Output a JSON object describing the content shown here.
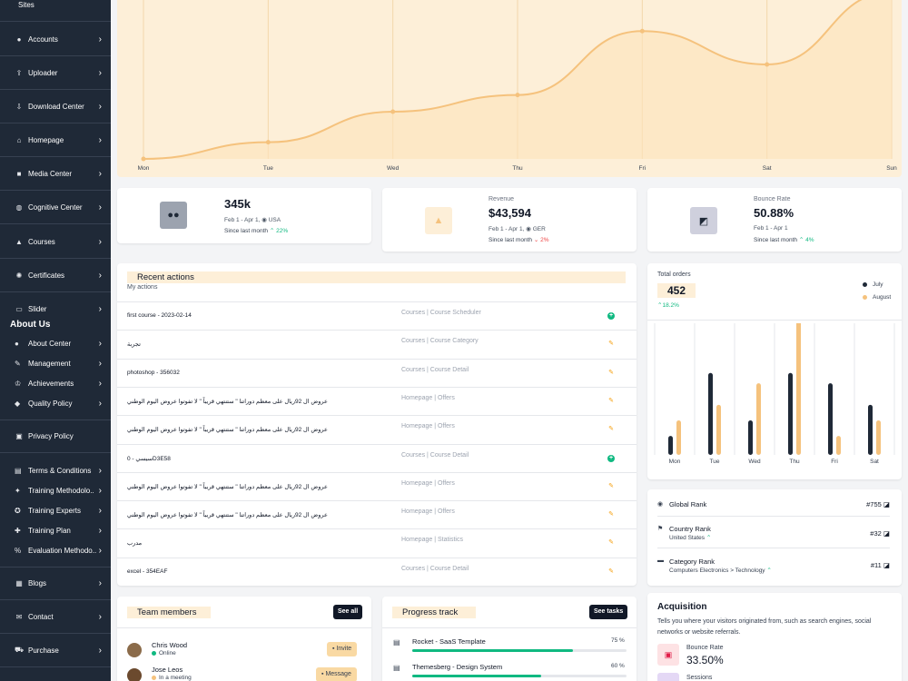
{
  "sidebar": {
    "items": [
      {
        "label": "Sites",
        "icon": "globe-icon"
      },
      {
        "label": "Accounts",
        "icon": "user-icon"
      },
      {
        "label": "Uploader",
        "icon": "upload-icon"
      },
      {
        "label": "Download Center",
        "icon": "download-icon"
      },
      {
        "label": "Homepage",
        "icon": "home-icon"
      },
      {
        "label": "Media Center",
        "icon": "video-icon"
      },
      {
        "label": "Cognitive Center",
        "icon": "brain-icon"
      },
      {
        "label": "Courses",
        "icon": "graduation-cap-icon"
      },
      {
        "label": "Certificates",
        "icon": "certificate-icon"
      },
      {
        "label": "Slider",
        "icon": "slider-icon"
      }
    ],
    "about_heading": "About Us",
    "about_items": [
      {
        "label": "About Center",
        "icon": "info-icon"
      },
      {
        "label": "Management",
        "icon": "gavel-icon"
      },
      {
        "label": "Achievements",
        "icon": "trophy-icon"
      },
      {
        "label": "Quality Policy",
        "icon": "shield-icon"
      }
    ],
    "privacy": {
      "label": "Privacy Policy",
      "icon": "lock-icon"
    },
    "group2": [
      {
        "label": "Terms & Conditions",
        "icon": "document-icon"
      },
      {
        "label": "Training Methodolo..",
        "icon": "method-icon"
      },
      {
        "label": "Training Experts",
        "icon": "expert-icon"
      },
      {
        "label": "Training Plan",
        "icon": "plan-icon"
      },
      {
        "label": "Evaluation Methodo..",
        "icon": "percent-icon"
      }
    ],
    "bottom": [
      {
        "label": "Blogs",
        "icon": "blog-icon"
      },
      {
        "label": "Contact",
        "icon": "mail-icon"
      },
      {
        "label": "Purchase",
        "icon": "cart-icon"
      }
    ]
  },
  "top_chart": {
    "days": [
      "Mon",
      "Tue",
      "Wed",
      "Thu",
      "Fri",
      "Sat",
      "Sun"
    ],
    "fill_color": "#fdefd8",
    "line_color": "#f5c27d"
  },
  "chart_data": [
    {
      "type": "area",
      "x": [
        "Mon",
        "Tue",
        "Wed",
        "Thu",
        "Fri",
        "Sat",
        "Sun"
      ],
      "values": [
        0.0,
        0.12,
        0.34,
        0.46,
        0.92,
        0.68,
        1.2
      ],
      "xlabel": "",
      "ylabel": "",
      "grid": true
    },
    {
      "type": "bar",
      "categories": [
        "Mon",
        "Tue",
        "Wed",
        "Thu",
        "Fri",
        "Sat"
      ],
      "series": [
        {
          "name": "July",
          "values": [
            22,
            95,
            40,
            95,
            83,
            58
          ],
          "color": "#1f2937"
        },
        {
          "name": "August",
          "values": [
            40,
            58,
            83,
            160,
            22,
            40
          ],
          "color": "#f5c27d"
        }
      ],
      "grid": true
    }
  ],
  "stats": [
    {
      "label": "",
      "value": "345k",
      "range": "Feb 1 - Apr 1,",
      "location": "USA",
      "since": "Since last month",
      "change": "22%",
      "direction": "up",
      "icon": "users-icon",
      "icon_bg": "#9ca3af"
    },
    {
      "label": "Revenue",
      "value": "$43,594",
      "range": "Feb 1 - Apr 1,",
      "location": "GER",
      "since": "Since last month",
      "change": "2%",
      "direction": "down",
      "icon": "shopping-bag-icon",
      "icon_bg": "#fdefd8"
    },
    {
      "label": "Bounce Rate",
      "value": "50.88%",
      "range": "Feb 1 - Apr 1",
      "location": "",
      "since": "Since last month",
      "change": "4%",
      "direction": "up",
      "icon": "presentation-icon",
      "icon_bg": "#cfd0dd"
    }
  ],
  "recent_actions": {
    "title": "Recent actions",
    "subtitle": "My actions",
    "rows": [
      {
        "name": "first course - 2023-02-14",
        "category": "Courses | Course Scheduler",
        "action": "add"
      },
      {
        "name": "تجربة",
        "category": "Courses | Course Category",
        "action": "edit"
      },
      {
        "name": "photoshop - 356032",
        "category": "Courses | Course Detail",
        "action": "edit"
      },
      {
        "name": "عروض ال 92ريال على معظم دوراتنا \" ستنتهي قريباً \" لا تفوتوا عروض اليوم الوطني",
        "category": "Homepage | Offers",
        "action": "edit"
      },
      {
        "name": "عروض ال 92ريال على معظم دوراتنا \" ستنتهي قريباً \" لا تفوتوا عروض اليوم الوطني",
        "category": "Homepage | Offers",
        "action": "edit"
      },
      {
        "name": "0 - سيسيD3E58",
        "category": "Courses | Course Detail",
        "action": "add"
      },
      {
        "name": "عروض ال 92ريال على معظم دوراتنا \" ستنتهي قريباً \" لا تفوتوا عروض اليوم الوطني",
        "category": "Homepage | Offers",
        "action": "edit"
      },
      {
        "name": "عروض ال 92ريال على معظم دوراتنا \" ستنتهي قريباً \" لا تفوتوا عروض اليوم الوطني",
        "category": "Homepage | Offers",
        "action": "edit"
      },
      {
        "name": "مدرب",
        "category": "Homepage | Statistics",
        "action": "edit"
      },
      {
        "name": "excel - 354EAF",
        "category": "Courses | Course Detail",
        "action": "edit"
      }
    ]
  },
  "total_orders": {
    "label": "Total orders",
    "value": "452",
    "change": "18.2%",
    "legend": [
      "July",
      "August"
    ]
  },
  "ranks": [
    {
      "title": "Global Rank",
      "sub": "",
      "value": "#755",
      "icon": "globe-icon"
    },
    {
      "title": "Country Rank",
      "sub": "United States",
      "value": "#32",
      "icon": "flag-icon"
    },
    {
      "title": "Category Rank",
      "sub": "Computers Electronics > Technology",
      "value": "#11",
      "icon": "folder-icon"
    }
  ],
  "team": {
    "title": "Team members",
    "see_all": "See all",
    "members": [
      {
        "name": "Chris Wood",
        "status": "Online",
        "status_color": "#10b981",
        "button": "Invite"
      },
      {
        "name": "Jose Leos",
        "status": "In a meeting",
        "status_color": "#f5c27d",
        "button": "Message"
      }
    ]
  },
  "progress": {
    "title": "Progress track",
    "see_tasks": "See tasks",
    "items": [
      {
        "name": "Rocket - SaaS Template",
        "percent_label": "75 %",
        "percent": 75
      },
      {
        "name": "Themesberg - Design System",
        "percent_label": "60 %",
        "percent": 60
      }
    ]
  },
  "acquisition": {
    "title": "Acquisition",
    "description": "Tells you where your visitors originated from, such as search engines, social networks or website referrals.",
    "metrics": [
      {
        "label": "Bounce Rate",
        "value": "33.50%",
        "icon": "chart-icon",
        "color": "#fde2e4"
      },
      {
        "label": "Sessions",
        "value": "",
        "icon": "session-icon",
        "color": "#e4d8f5"
      }
    ]
  }
}
